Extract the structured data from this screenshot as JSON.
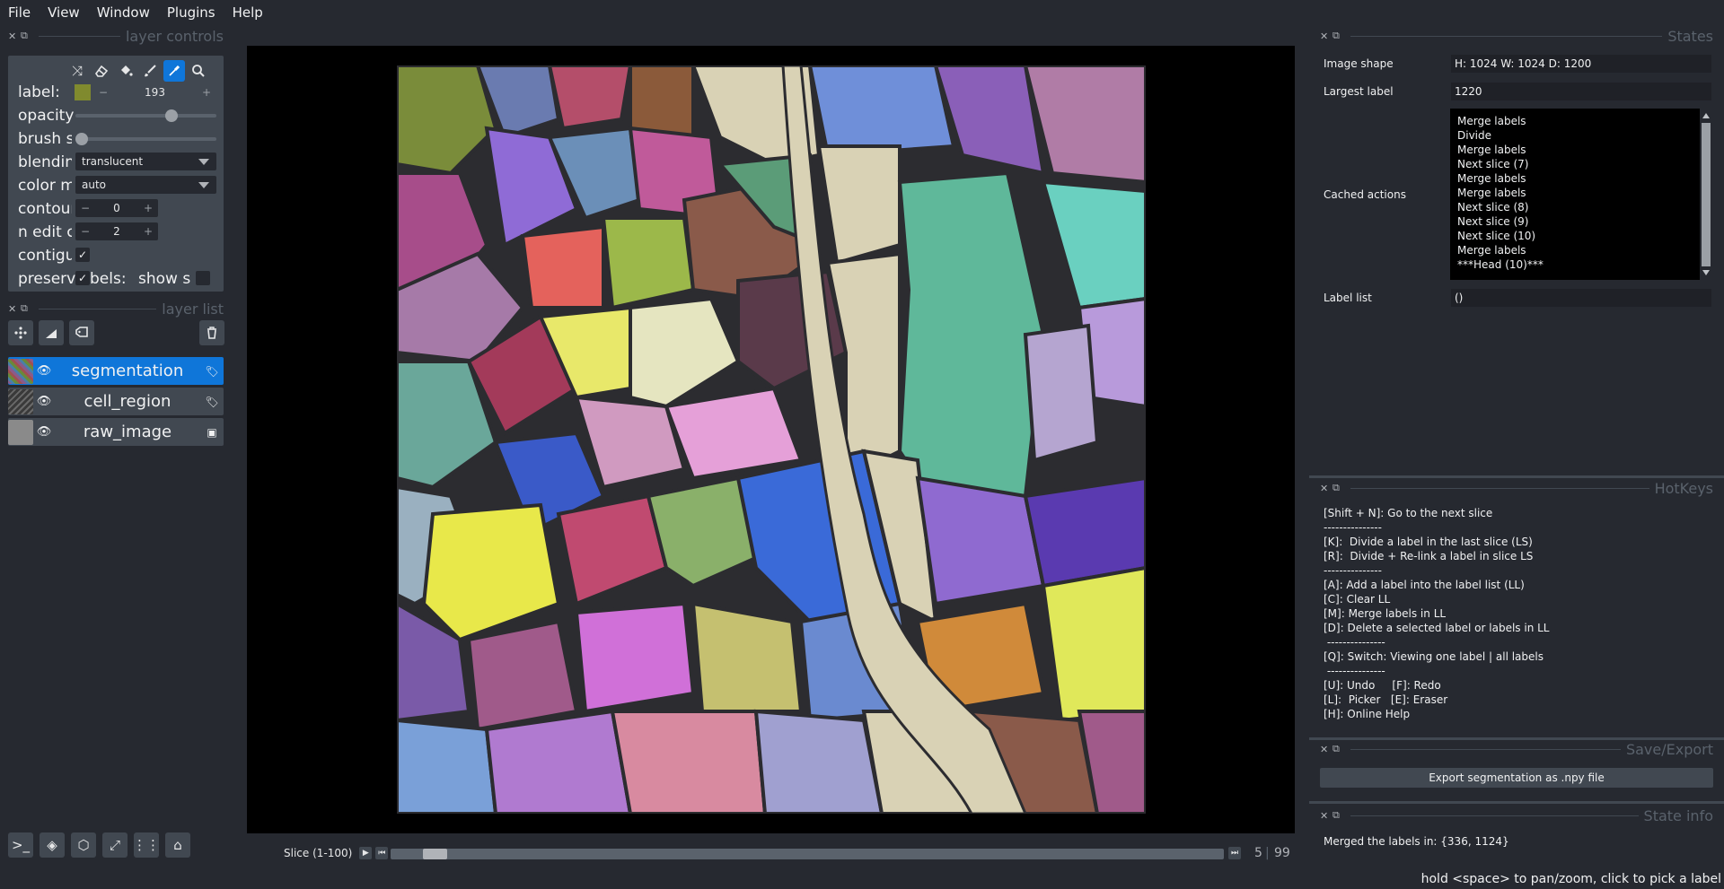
{
  "menu": [
    "File",
    "View",
    "Window",
    "Plugins",
    "Help"
  ],
  "layer_controls": {
    "title": "layer controls",
    "label_label": "label:",
    "label_value": "193",
    "label_color": "#808a2e",
    "opacity_label": "opacity",
    "opacity_value": 0.7,
    "brush_label": "brush s",
    "brush_value": 0.0,
    "blending_label": "blendin",
    "blending_value": "translucent",
    "colormode_label": "color m",
    "colormode_value": "auto",
    "contour_label": "contour",
    "contour_value": "0",
    "nedit_label": "n edit c",
    "nedit_value": "2",
    "contiguous_label": "contigu",
    "preserve_label": "preserve",
    "preserve_tail": "bels:",
    "show_label": "show s",
    "tools": [
      "shuffle-icon",
      "eraser-icon",
      "fill-bucket-icon",
      "paintbrush-icon",
      "color-picker-icon",
      "zoom-icon"
    ],
    "active_tool": "color-picker-icon"
  },
  "layer_list": {
    "title": "layer list",
    "layers": [
      {
        "name": "segmentation",
        "selected": true
      },
      {
        "name": "cell_region",
        "selected": false
      },
      {
        "name": "raw_image",
        "selected": false
      }
    ]
  },
  "slice": {
    "label": "Slice (1-100)",
    "current": "5",
    "max": "99",
    "position": 0.04
  },
  "states": {
    "title": "States",
    "image_shape_label": "Image shape",
    "image_shape_value": "H: 1024  W: 1024  D: 1200",
    "largest_label_label": "Largest label",
    "largest_label_value": "1220",
    "cached_label": "Cached actions",
    "cached_actions": [
      "Merge labels",
      "Divide",
      "Merge labels",
      "Next slice (7)",
      "Merge labels",
      "Merge labels",
      "Next slice (8)",
      "Next slice (9)",
      "Next slice (10)",
      "Merge labels",
      "***Head (10)***"
    ],
    "label_list_label": "Label list",
    "label_list_value": "()"
  },
  "hotkeys": {
    "title": "HotKeys",
    "lines": [
      "[Shift + N]: Go to the next slice",
      "---------------",
      "[K]:  Divide a label in the last slice (LS)",
      "[R]:  Divide + Re-link a label in slice LS",
      "---------------",
      "[A]: Add a label into the label list (LL)",
      "[C]: Clear LL",
      "[M]: Merge labels in LL",
      "[D]: Delete a selected label or labels in LL",
      " ---------------",
      "[Q]: Switch: Viewing one label | all labels",
      " ---------------",
      "[U]: Undo     [F]: Redo",
      "[L]:  Picker   [E]: Eraser",
      "[H]: Online Help"
    ]
  },
  "save_export": {
    "title": "Save/Export",
    "button": "Export segmentation as .npy file"
  },
  "state_info": {
    "title": "State info",
    "text": "Merged the labels in: {336, 1124}"
  },
  "status": "hold <space> to pan/zoom, click to pick a label"
}
